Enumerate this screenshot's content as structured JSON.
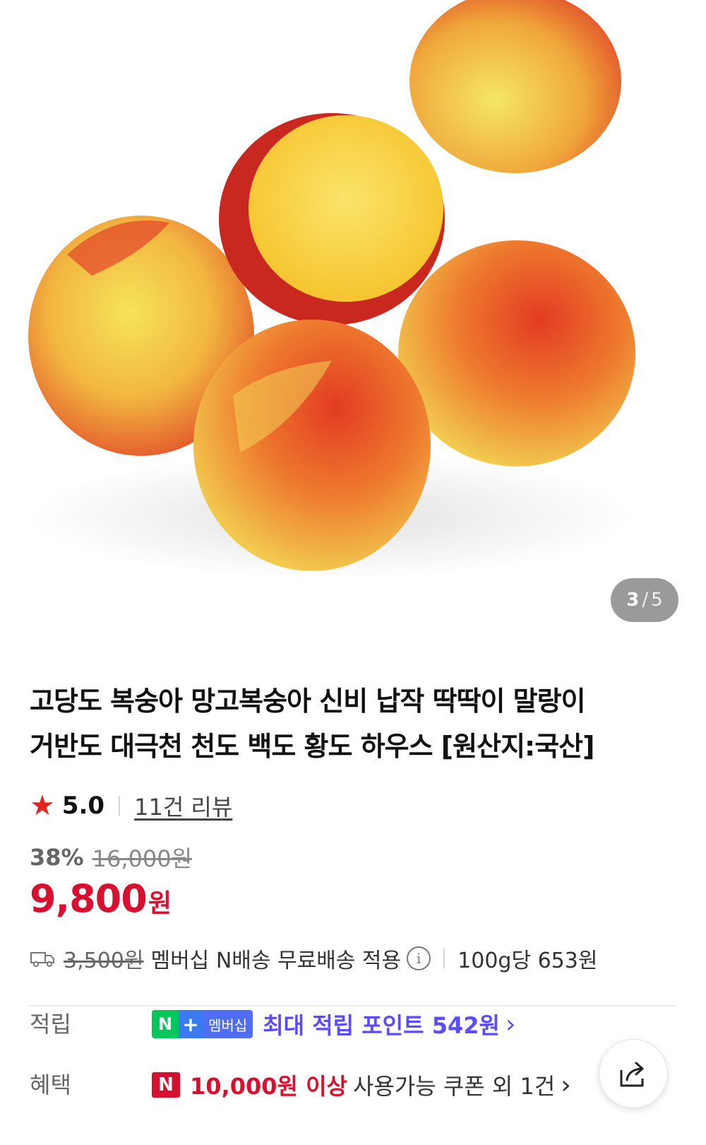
{
  "gallery": {
    "current": "3",
    "separator": "/",
    "total": "5",
    "image_alt": "peaches-photo"
  },
  "product": {
    "title_line1": "고당도 복숭아 망고복숭아 신비 납작 딱딱이 말랑이",
    "title_line2": "거반도 대극천 천도 백도 황도 하우스 [원산지:국산]"
  },
  "rating": {
    "score": "5.0",
    "reviews_label": "11건 리뷰"
  },
  "pricing": {
    "discount": "38%",
    "original_price": "16,000원",
    "price": "9,800",
    "currency": "원",
    "accent_color": "#d7102f"
  },
  "shipping": {
    "original_fee": "3,500원",
    "text": "멤버십 N배송 무료배송 적용",
    "unit_price": "100g당 653원"
  },
  "benefits": {
    "points_label": "적립",
    "badge_n": "N",
    "badge_plus": "+",
    "badge_membership": "멤버십",
    "points_text": "최대 적립 포인트 542원",
    "chevron": "›",
    "coupon_label": "혜택",
    "coupon_badge": "N",
    "coupon_strong": "10,000원 이상",
    "coupon_text": "사용가능 쿠폰 외 1건",
    "points_color": "#5b4bff"
  },
  "icons": {
    "star": "star-icon",
    "truck": "truck-icon",
    "info": "info-icon",
    "share": "share-icon"
  }
}
